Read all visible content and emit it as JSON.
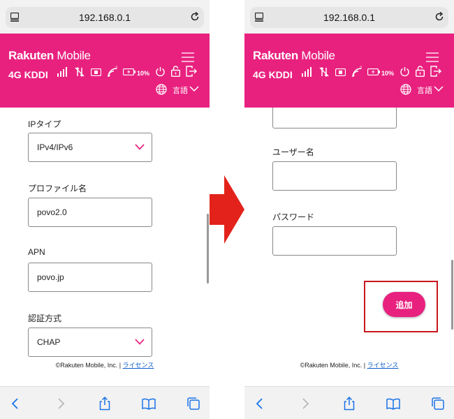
{
  "browser": {
    "url": "192.168.0.1",
    "icons": [
      "reader-icon",
      "reload-icon"
    ]
  },
  "header": {
    "logo_bold": "Rakuten",
    "logo_light": "Mobile",
    "network": "4G KDDI",
    "battery": "10%",
    "language_label": "言語",
    "brand_color": "#e8217f"
  },
  "left_form": {
    "ip_type_label": "IPタイプ",
    "ip_type_value": "IPv4/IPv6",
    "profile_label": "プロファイル名",
    "profile_value": "povo2.0",
    "apn_label": "APN",
    "apn_value": "povo.jp",
    "auth_label": "認証方式",
    "auth_value": "CHAP"
  },
  "right_form": {
    "username_label": "ユーザー名",
    "username_value": "",
    "password_label": "パスワード",
    "password_value": "",
    "add_button": "追加"
  },
  "footer": {
    "copyright": "©Rakuten Mobile, Inc. | ",
    "license_link": "ライセンス"
  },
  "colors": {
    "arrow": "#e3231b",
    "highlight_box": "#c8161d"
  }
}
